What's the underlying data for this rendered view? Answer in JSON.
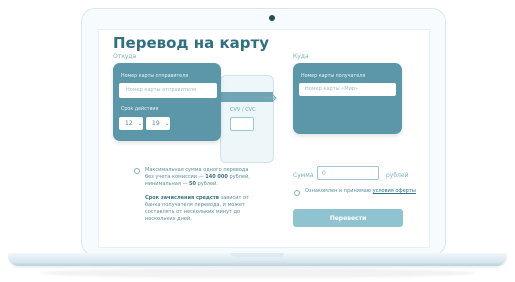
{
  "screen": {
    "title": "Перевод на карту",
    "sections": {
      "from_label": "Откуда",
      "to_label": "Куда"
    },
    "from_card": {
      "number_label": "Номер карты отправителя",
      "number_placeholder": "Номер карты отправителя",
      "expiry_label": "Срок действия",
      "month_value": "12",
      "year_value": "19",
      "cvv_label": "CVV / CVC"
    },
    "to_card": {
      "number_label": "Номер карты получателя",
      "number_placeholder": "Номер карты «Мир»"
    },
    "info": {
      "line1": "Максимальная сумма одного перевода без учета комиссии —",
      "line1_bold": "140 000",
      "line1_tail": "рублей, минимальная —",
      "line1_min": "50",
      "line1_min_tail": "рублей.",
      "line2_bold": "Срок зачисления средств",
      "line2_tail": "зависит от банка получателя перевода, и может составлять от нескольких минут до нескольких дней."
    },
    "amount": {
      "label": "Сумма",
      "value": "0",
      "currency": "рублей"
    },
    "agreement": {
      "text": "Ознакомлен и принимаю",
      "link_text": "условия оферты"
    },
    "submit_label": "Перевести"
  },
  "icons": {
    "arrow": "arrow-right-icon",
    "chevron": "chevron-down-icon",
    "info": "info-icon",
    "checkbox": "checkbox-icon"
  },
  "colors": {
    "accent": "#5b97a8",
    "title": "#2f6f80",
    "muted": "#7fb1be",
    "button": "#8fc3cf"
  }
}
